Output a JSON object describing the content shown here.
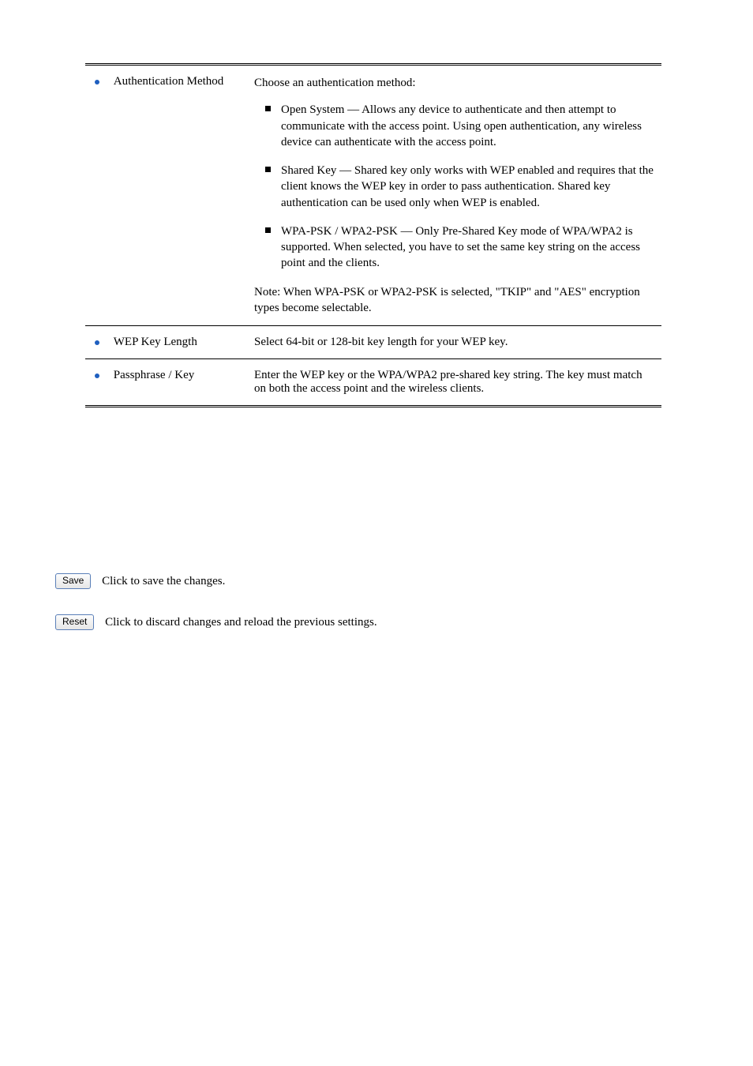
{
  "rows": [
    {
      "label": "Authentication Method",
      "intro": "Choose an authentication method:",
      "items": [
        "Open System — Allows any device to authenticate and then attempt to communicate with the access point. Using open authentication, any wireless device can authenticate with the access point.",
        "Shared Key — Shared key only works with WEP enabled and requires that the client knows the WEP key in order to pass authentication. Shared key authentication can be used only when WEP is enabled.",
        "WPA-PSK / WPA2-PSK — Only Pre-Shared Key mode of WPA/WPA2 is supported. When selected, you have to set the same key string on the access point and the clients."
      ],
      "note": "Note: When WPA-PSK or WPA2-PSK is selected, \"TKIP\" and \"AES\" encryption types become selectable."
    },
    {
      "label": "WEP Key Length",
      "plain": "Select 64-bit or 128-bit key length for your WEP key."
    },
    {
      "label": "Passphrase / Key",
      "plain": "Enter the WEP key or the WPA/WPA2 pre-shared key string. The key must match on both the access point and the wireless clients."
    }
  ],
  "buttons": {
    "save": {
      "label": "Save",
      "desc": "Click to save the changes."
    },
    "reset": {
      "label": "Reset",
      "desc": "Click to discard changes and reload the previous settings."
    }
  }
}
